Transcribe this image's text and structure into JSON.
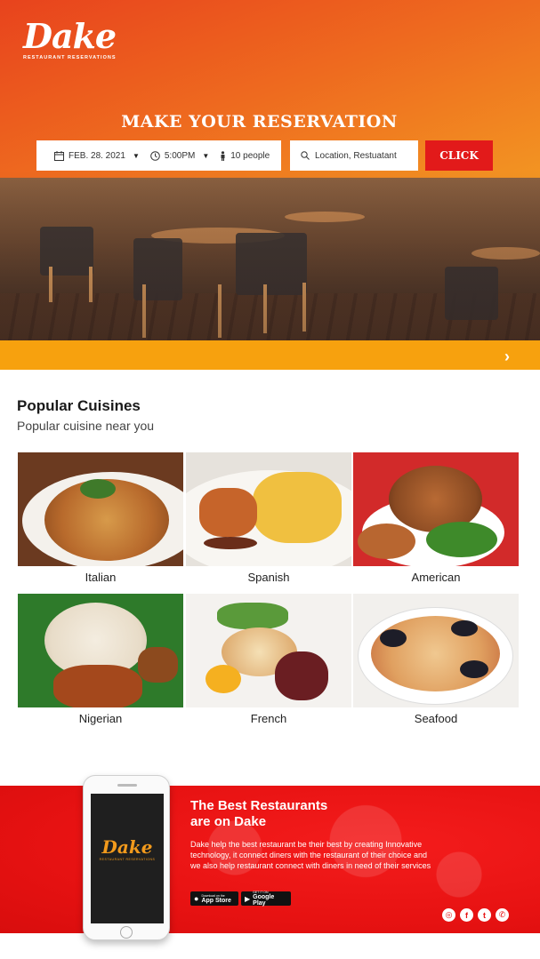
{
  "brand": {
    "name": "Dake",
    "tagline": "RESTAURANT RESERVATIONS"
  },
  "hero": {
    "title": "MAKE YOUR RESERVATION",
    "date": "FEB. 28. 2021",
    "time": "5:00PM",
    "people": "10 people",
    "location_placeholder": "Location, Restuatant",
    "cta": "CLICK",
    "colors": {
      "gradient_start": "#e8431d",
      "gradient_end": "#f6a228",
      "cta": "#e21a1a",
      "strip": "#f7a10e"
    }
  },
  "popular": {
    "title": "Popular Cuisines",
    "subtitle": "Popular cuisine near you",
    "cuisines": [
      {
        "label": "Italian"
      },
      {
        "label": "Spanish"
      },
      {
        "label": "American"
      },
      {
        "label": "Nigerian"
      },
      {
        "label": "French"
      },
      {
        "label": "Seafood"
      }
    ]
  },
  "banner": {
    "title_line1": "The Best Restaurants",
    "title_line2": "are on Dake",
    "text": "Dake help the best restaurant be their best by creating Innovative technology, it connect diners with the restaurant of their choice and we also help restaurant connect with diners in need of their services",
    "app_store_small": "Download on the",
    "app_store": "App Store",
    "google_play_small": "GET IT ON",
    "google_play": "Google Play",
    "color": "#e71212"
  },
  "social_icons": [
    "instagram-icon",
    "facebook-icon",
    "twitter-icon",
    "whatsapp-icon"
  ]
}
